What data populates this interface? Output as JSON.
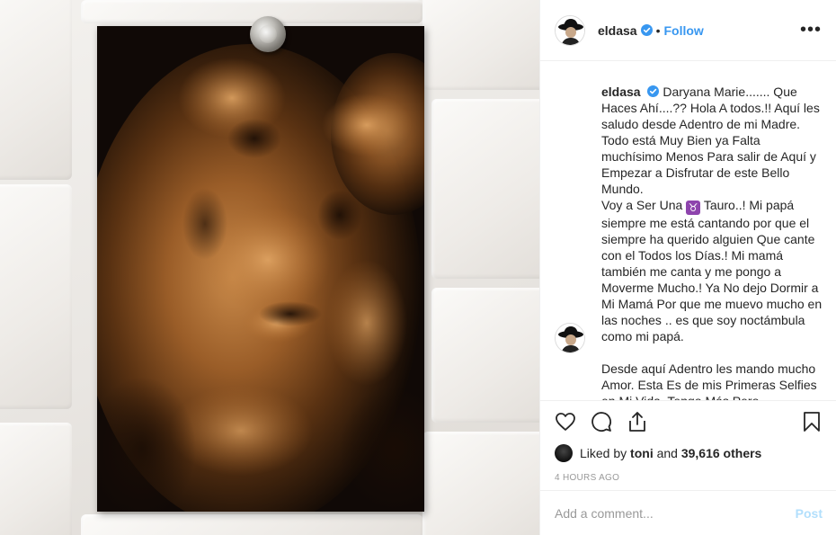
{
  "post": {
    "username": "eldasa",
    "follow_label": "Follow",
    "separator": "•",
    "more_label": "•••",
    "caption_username": "eldasa",
    "caption_lines": [
      "Daryana Marie....... Que Haces Ahí....?? Hola A todos.!! Aquí les saludo desde Adentro de mi Madre. Todo está Muy Bien ya Falta muchísimo Menos Para salir de Aquí y Empezar a Disfrutar de este Bello Mundo."
    ],
    "caption_line2_pre": "Voy a Ser Una",
    "caption_sign": "♉",
    "caption_line2_post": "Tauro..! Mi papá siempre me está cantando por que el siempre ha querido alguien Que cante con el Todos los Días.! Mi mamá también me canta y me pongo a Moverme Mucho.! Ya No dejo Dormir a Mi Mamá Por que me muevo mucho en las noches .. es que soy noctámbula como mi papá.",
    "caption_line3": "Desde aquí Adentro les mando mucho Amor. Esta Es de mis Primeras Selfies en Mi Vida. Tengo Más Pero",
    "likes_prefix": "Liked by",
    "likes_user": "toni",
    "likes_and": "and",
    "likes_count": "39,616 others",
    "timestamp": "4 HOURS AGO",
    "comment_placeholder": "Add a comment...",
    "post_label": "Post"
  },
  "icons": {
    "verified": "verified-badge-icon",
    "like": "heart-icon",
    "comment": "comment-bubble-icon",
    "share": "share-icon",
    "save": "bookmark-icon"
  },
  "colors": {
    "link_blue": "#3897f0",
    "post_disabled": "#b2dffc",
    "muted": "#999999",
    "text": "#262626"
  }
}
